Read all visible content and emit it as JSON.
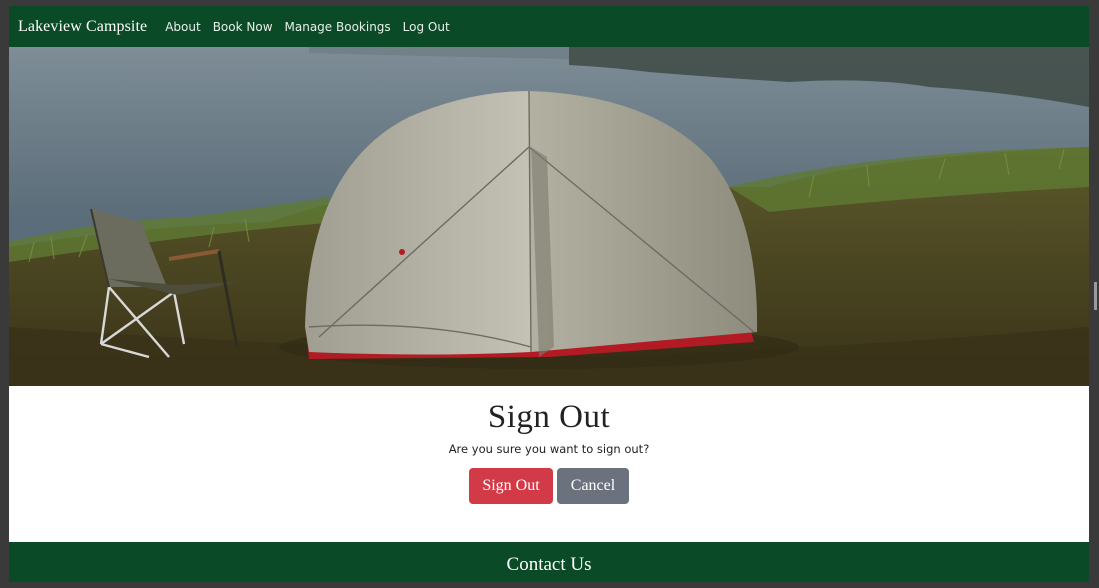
{
  "navbar": {
    "brand": "Lakeview Campsite",
    "links": [
      "About",
      "Book Now",
      "Manage Bookings",
      "Log Out"
    ]
  },
  "hero": {
    "image": "camping-tent-by-lake"
  },
  "signout": {
    "title": "Sign Out",
    "message": "Are you sure you want to sign out?",
    "confirm_label": "Sign Out",
    "cancel_label": "Cancel"
  },
  "footer": {
    "heading": "Contact Us"
  },
  "colors": {
    "nav_bg": "#0b4a26",
    "danger": "#d23a48",
    "secondary": "#6c727d"
  }
}
